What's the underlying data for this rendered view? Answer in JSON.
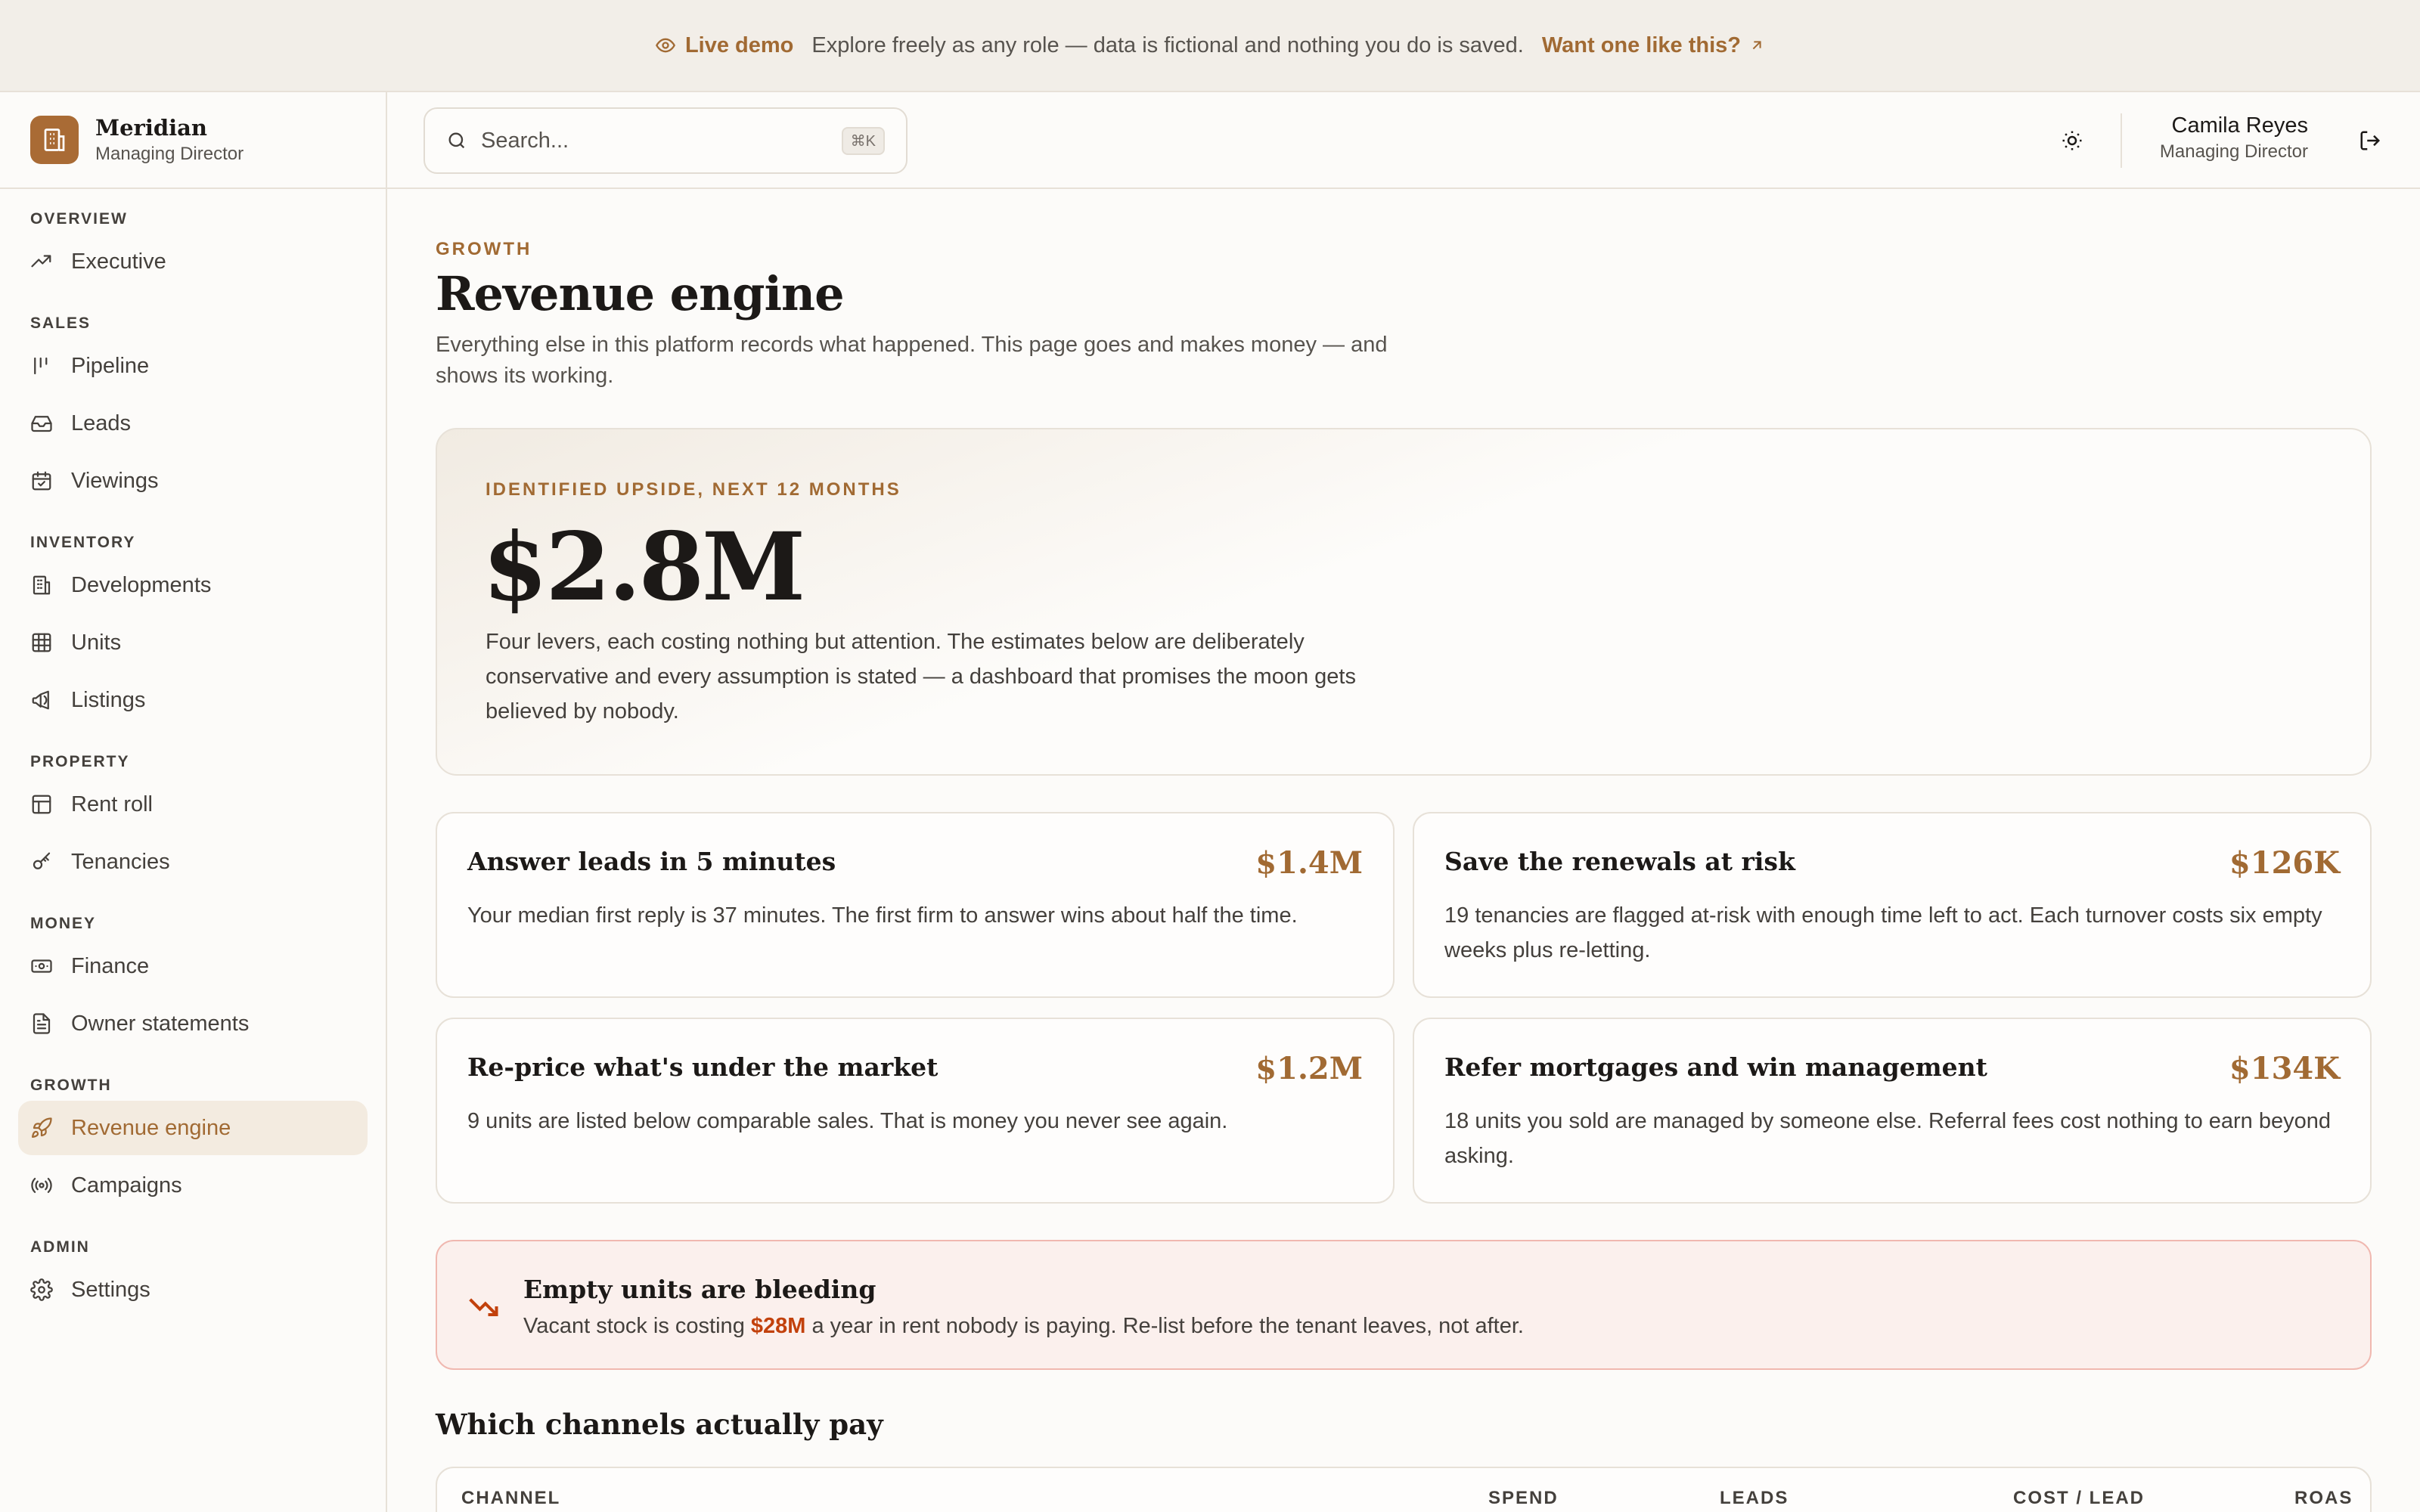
{
  "banner": {
    "live_label": "Live demo",
    "message": "Explore freely as any role — data is fictional and nothing you do is saved.",
    "cta_label": "Want one like this?"
  },
  "brand": {
    "name": "Meridian",
    "role": "Managing Director"
  },
  "sidebar": {
    "sections": [
      {
        "title": "OVERVIEW",
        "items": [
          {
            "label": "Executive",
            "icon": "trending-up-icon"
          }
        ]
      },
      {
        "title": "SALES",
        "items": [
          {
            "label": "Pipeline",
            "icon": "kanban-icon"
          },
          {
            "label": "Leads",
            "icon": "inbox-icon"
          },
          {
            "label": "Viewings",
            "icon": "calendar-check-icon"
          }
        ]
      },
      {
        "title": "INVENTORY",
        "items": [
          {
            "label": "Developments",
            "icon": "building-icon"
          },
          {
            "label": "Units",
            "icon": "grid-icon"
          },
          {
            "label": "Listings",
            "icon": "megaphone-icon"
          }
        ]
      },
      {
        "title": "PROPERTY",
        "items": [
          {
            "label": "Rent roll",
            "icon": "table-icon"
          },
          {
            "label": "Tenancies",
            "icon": "key-icon"
          }
        ]
      },
      {
        "title": "MONEY",
        "items": [
          {
            "label": "Finance",
            "icon": "banknote-icon"
          },
          {
            "label": "Owner statements",
            "icon": "file-text-icon"
          }
        ]
      },
      {
        "title": "GROWTH",
        "items": [
          {
            "label": "Revenue engine",
            "icon": "rocket-icon",
            "active": true
          },
          {
            "label": "Campaigns",
            "icon": "radio-icon"
          }
        ]
      },
      {
        "title": "ADMIN",
        "items": [
          {
            "label": "Settings",
            "icon": "gear-icon"
          }
        ]
      }
    ]
  },
  "topbar": {
    "search_placeholder": "Search...",
    "search_shortcut": "⌘K",
    "user_name": "Camila Reyes",
    "user_role": "Managing Director"
  },
  "page": {
    "eyebrow": "GROWTH",
    "title": "Revenue engine",
    "description": "Everything else in this platform records what happened. This page goes and makes money — and shows its working."
  },
  "hero": {
    "eyebrow": "IDENTIFIED UPSIDE, NEXT 12 MONTHS",
    "value": "$2.8M",
    "description": "Four levers, each costing nothing but attention. The estimates below are deliberately conservative and every assumption is stated — a dashboard that promises the moon gets believed by nobody."
  },
  "levers": [
    {
      "title": "Answer leads in 5 minutes",
      "value": "$1.4M",
      "description": "Your median first reply is 37 minutes. The first firm to answer wins about half the time."
    },
    {
      "title": "Save the renewals at risk",
      "value": "$126K",
      "description": "19 tenancies are flagged at-risk with enough time left to act. Each turnover costs six empty weeks plus re-letting."
    },
    {
      "title": "Re-price what's under the market",
      "value": "$1.2M",
      "description": "9 units are listed below comparable sales. That is money you never see again."
    },
    {
      "title": "Refer mortgages and win management",
      "value": "$134K",
      "description": "18 units you sold are managed by someone else. Referral fees cost nothing to earn beyond asking."
    }
  ],
  "alert": {
    "title": "Empty units are bleeding",
    "text_before": "Vacant stock is costing ",
    "amount": "$28M",
    "text_after": " a year in rent nobody is paying. Re-list before the tenant leaves, not after."
  },
  "channels": {
    "title": "Which channels actually pay",
    "columns": [
      "CHANNEL",
      "SPEND",
      "LEADS",
      "COST / LEAD",
      "ROAS"
    ]
  },
  "colors": {
    "accent": "#a16a33",
    "alert": "#c2410c"
  }
}
